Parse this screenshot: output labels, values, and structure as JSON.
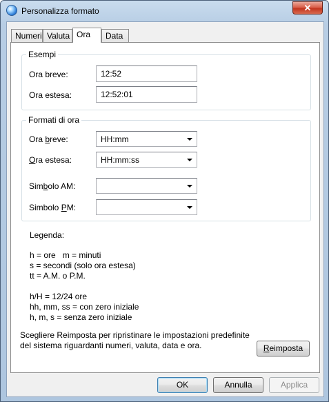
{
  "window": {
    "title": "Personalizza formato",
    "close_glyph": "✕",
    "app_icon": "globe-icon"
  },
  "tabs": [
    {
      "label": "Numeri"
    },
    {
      "label": "Valuta"
    },
    {
      "label": "Ora",
      "active": true
    },
    {
      "label": "Data"
    }
  ],
  "examples": {
    "title": "Esempi",
    "short_label": "Ora breve:",
    "short_value": "12:52",
    "long_label": "Ora estesa:",
    "long_value": "12:52:01"
  },
  "formats": {
    "title": "Formati di ora",
    "short_label_pre": "Ora ",
    "short_label_key": "b",
    "short_label_post": "reve:",
    "short_value": "HH:mm",
    "long_label_key": "O",
    "long_label_post": "ra estesa:",
    "long_value": "HH:mm:ss",
    "am_label_pre": "Sim",
    "am_label_key": "b",
    "am_label_post": "olo AM:",
    "am_value": "",
    "pm_label_pre": "Simbolo ",
    "pm_label_key": "P",
    "pm_label_post": "M:",
    "pm_value": ""
  },
  "legend": {
    "title": "Legenda:",
    "lines": [
      "h = ore   m = minuti",
      "s = secondi (solo ora estesa)",
      "tt = A.M. o P.M.",
      "h/H = 12/24 ore",
      "hh, mm, ss = con zero iniziale",
      "h, m, s = senza zero iniziale"
    ]
  },
  "reset": {
    "text_line1": "Scegliere Reimposta per ripristinare le impostazioni predefinite",
    "text_line2": "del sistema riguardanti numeri, valuta, data e ora.",
    "button_key": "R",
    "button_rest": "eimposta"
  },
  "buttons": {
    "ok": "OK",
    "cancel": "Annulla",
    "apply": "Applica"
  }
}
